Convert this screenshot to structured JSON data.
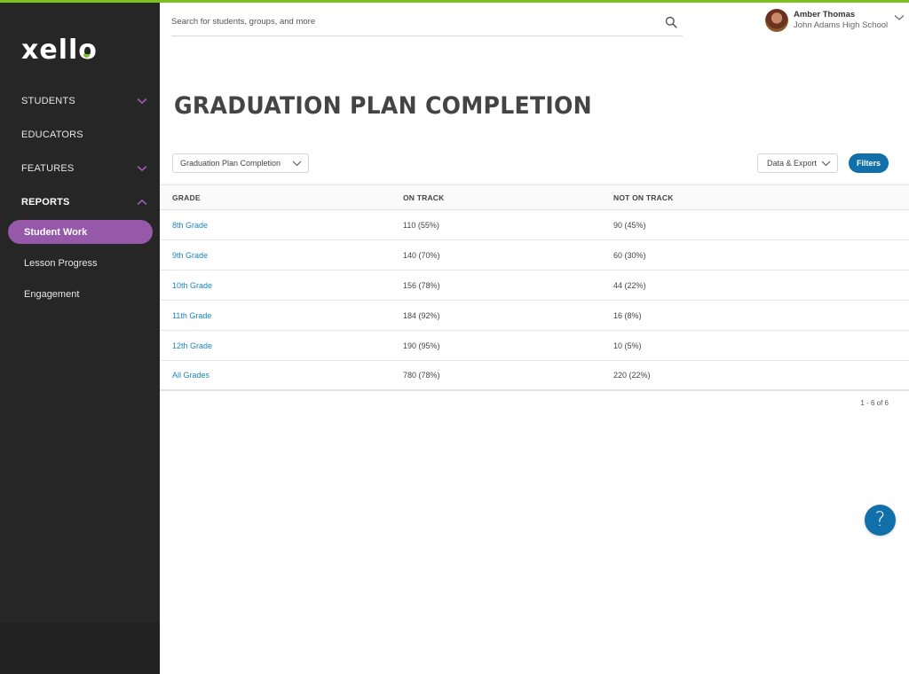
{
  "brand": {
    "logo_text": "xell",
    "logo_last": "o",
    "accent": "#7dc11f",
    "purple": "#9658a8",
    "blue": "#1170a9"
  },
  "sidebar": {
    "items": [
      {
        "label": "STUDENTS",
        "icon": "chevron-down-icon",
        "expanded": false
      },
      {
        "label": "EDUCATORS",
        "icon": null,
        "expanded": false
      },
      {
        "label": "FEATURES",
        "icon": "chevron-down-icon",
        "expanded": false
      },
      {
        "label": "REPORTS",
        "icon": "chevron-up-icon",
        "expanded": true
      }
    ],
    "reports_subitems": [
      {
        "label": "Student Work",
        "active": true
      },
      {
        "label": "Lesson Progress",
        "active": false
      },
      {
        "label": "Engagement",
        "active": false
      }
    ]
  },
  "header": {
    "search": {
      "placeholder": "Search for students, groups, and more",
      "value": "",
      "icon": "search-icon"
    },
    "user": {
      "name": "Amber Thomas",
      "school": "John Adams High School"
    }
  },
  "main": {
    "title": "GRADUATION PLAN COMPLETION",
    "report_select": {
      "selected": "Graduation Plan Completion"
    },
    "export_label": "Data & Export",
    "filters_label": "Filters",
    "table": {
      "columns": [
        "GRADE",
        "ON TRACK",
        "NOT ON TRACK"
      ],
      "rows": [
        {
          "grade": "8th Grade",
          "on_track": "110 (55%)",
          "not_on_track": "90 (45%)"
        },
        {
          "grade": "9th Grade",
          "on_track": "140 (70%)",
          "not_on_track": "60 (30%)"
        },
        {
          "grade": "10th Grade",
          "on_track": "156 (78%)",
          "not_on_track": "44 (22%)"
        },
        {
          "grade": "11th Grade",
          "on_track": "184 (92%)",
          "not_on_track": "16 (8%)"
        },
        {
          "grade": "12th Grade",
          "on_track": "190 (95%)",
          "not_on_track": "10 (5%)"
        },
        {
          "grade": "All Grades",
          "on_track": "780 (78%)",
          "not_on_track": "220 (22%)"
        }
      ]
    },
    "pagination": "1 - 6 of 6",
    "help_label": "?"
  }
}
